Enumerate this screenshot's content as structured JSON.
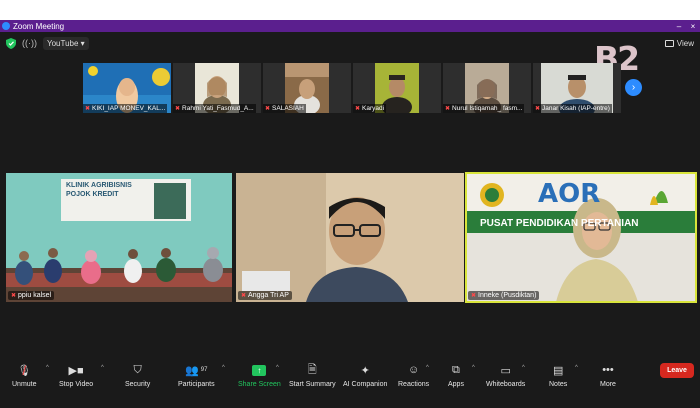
{
  "window": {
    "title": "Zoom Meeting"
  },
  "topbar": {
    "stream_label": "YouTube",
    "view_label": "View"
  },
  "watermark": {
    "text": "B2",
    "sub": "..."
  },
  "strip": [
    {
      "name": "KIKI_IAP MONEV_KAL..."
    },
    {
      "name": "Rahmi Yati_Fasmud_A..."
    },
    {
      "name": "SALASIAH"
    },
    {
      "name": "Karyadi"
    },
    {
      "name": "Nurul Istiqamah_ fasm..."
    },
    {
      "name": "Janar Kisah (IAP-entre)"
    }
  ],
  "gallery": [
    {
      "name": "ppiu kalsel",
      "banner_line1": "KLINIK AGRIBISNIS",
      "banner_line2": "POJOK KREDIT"
    },
    {
      "name": "Angga Tri AP"
    },
    {
      "name": "Inneke (Pusdiktan)",
      "wall_text": "PUSAT PENDIDIKAN PERTANIAN",
      "logo_text": "AOR"
    }
  ],
  "toolbar": {
    "unmute": "Unmute",
    "stop_video": "Stop Video",
    "security": "Security",
    "participants": "Participants",
    "participants_count": "97",
    "share_screen": "Share Screen",
    "start_summary": "Start Summary",
    "ai_companion": "AI Companion",
    "reactions": "Reactions",
    "apps": "Apps",
    "whiteboards": "Whiteboards",
    "notes": "Notes",
    "more": "More",
    "leave": "Leave"
  },
  "colors": {
    "titlebar": "#5b1f8e",
    "active_speaker": "#d9e53b",
    "share_green": "#22c55e",
    "leave_red": "#d6281f",
    "zoom_blue": "#2d8cff"
  }
}
